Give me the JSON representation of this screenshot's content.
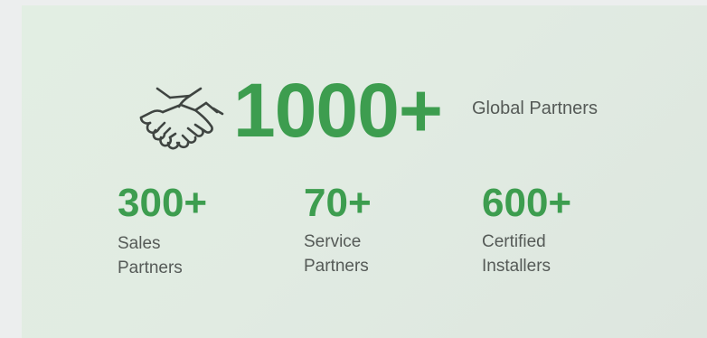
{
  "hero": {
    "icon": "handshake-icon",
    "value": "1000+",
    "label": "Global Partners"
  },
  "stats": [
    {
      "value": "300+",
      "label": "Sales\nPartners"
    },
    {
      "value": "70+",
      "label": "Service\nPartners"
    },
    {
      "value": "600+",
      "label": "Certified\nInstallers"
    }
  ],
  "colors": {
    "accent": "#3d9d4f",
    "text": "#555a57",
    "panel_background": "#e1ebe2",
    "page_background": "#eceeee",
    "icon_stroke": "#3f4441"
  }
}
